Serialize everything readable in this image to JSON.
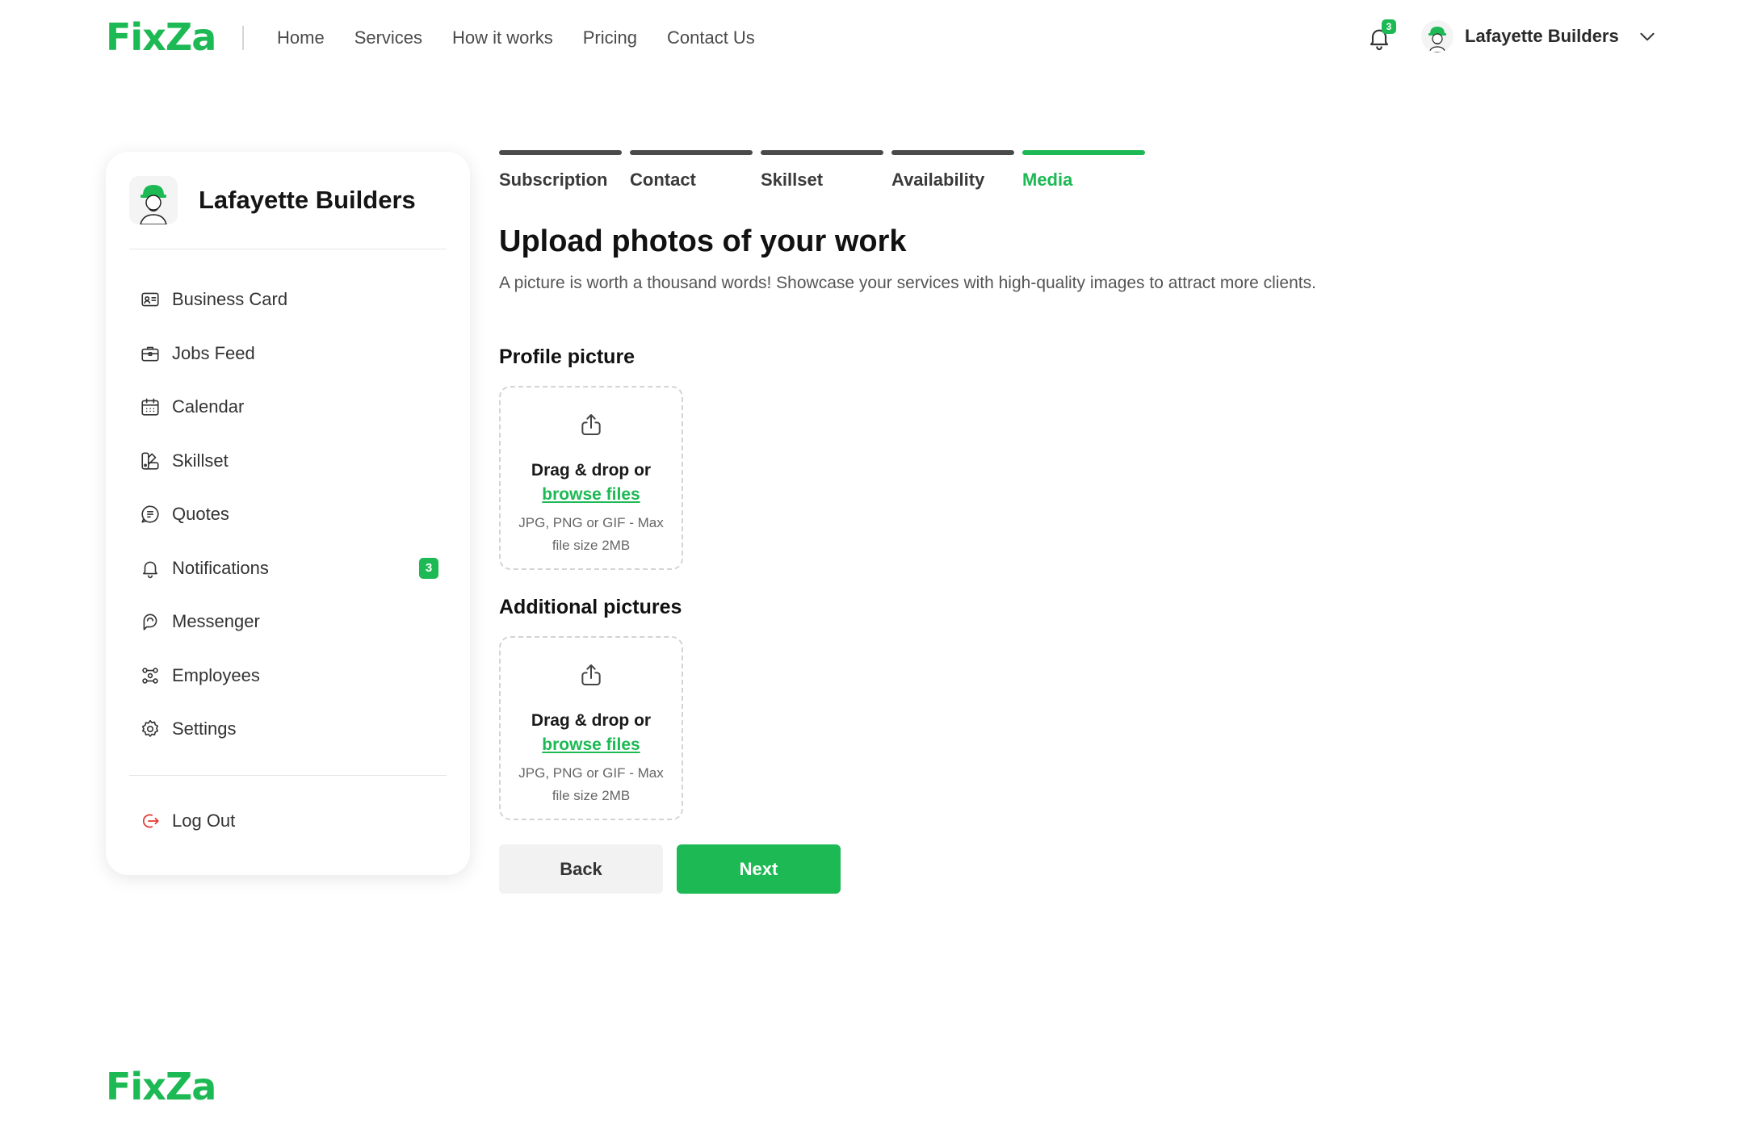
{
  "brand": {
    "name": "FixZa",
    "accent_color": "#1db954"
  },
  "nav": {
    "links": [
      {
        "label": "Home"
      },
      {
        "label": "Services"
      },
      {
        "label": "How it works"
      },
      {
        "label": "Pricing"
      },
      {
        "label": "Contact Us"
      }
    ]
  },
  "header": {
    "notification_count": "3",
    "user_name": "Lafayette Builders",
    "icons": {
      "bell": "bell-icon",
      "menu": "chevron-down-icon"
    }
  },
  "sidebar": {
    "profile_name": "Lafayette Builders",
    "items": [
      {
        "label": "Business Card",
        "icon": "id-card-icon"
      },
      {
        "label": "Jobs Feed",
        "icon": "briefcase-icon"
      },
      {
        "label": "Calendar",
        "icon": "calendar-icon"
      },
      {
        "label": "Skillset",
        "icon": "swatch-icon"
      },
      {
        "label": "Quotes",
        "icon": "quote-bubble-icon"
      },
      {
        "label": "Notifications",
        "icon": "bell-icon",
        "badge": "3"
      },
      {
        "label": "Messenger",
        "icon": "chat-icon"
      },
      {
        "label": "Employees",
        "icon": "users-icon"
      },
      {
        "label": "Settings",
        "icon": "gear-icon"
      }
    ],
    "logout_label": "Log Out",
    "logout_color": "#e53935"
  },
  "steps": [
    {
      "label": "Subscription",
      "active": false
    },
    {
      "label": "Contact",
      "active": false
    },
    {
      "label": "Skillset",
      "active": false
    },
    {
      "label": "Availability",
      "active": false
    },
    {
      "label": "Media",
      "active": true
    }
  ],
  "main": {
    "title": "Upload photos of your work",
    "description": "A picture is worth a thousand words! Showcase your services with high-quality images to attract more clients.",
    "profile_section": {
      "label": "Profile picture",
      "drop_text": "Drag & drop or",
      "browse_text": "browse files",
      "hint": "JPG, PNG or GIF - Max file size 2MB"
    },
    "additional_section": {
      "label": "Additional pictures",
      "drop_text": "Drag & drop or",
      "browse_text": "browse files",
      "hint": "JPG, PNG or GIF - Max file size 2MB"
    },
    "back_label": "Back",
    "next_label": "Next"
  },
  "footer": {
    "brand": "FixZa"
  }
}
